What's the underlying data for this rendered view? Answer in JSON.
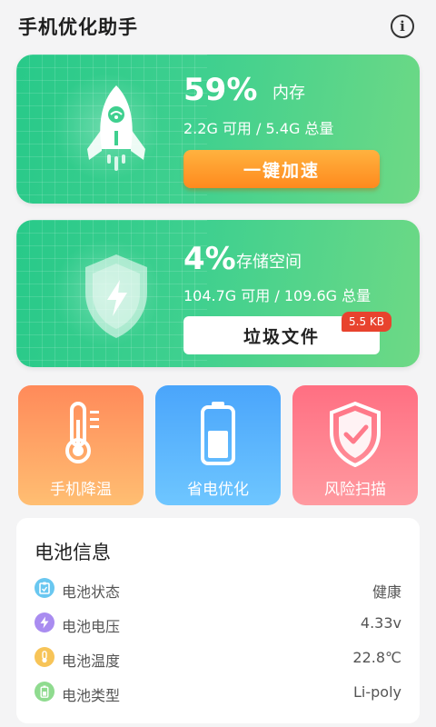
{
  "header": {
    "title": "手机优化助手",
    "info_icon": "info-icon"
  },
  "memory": {
    "percent": "59%",
    "label": "内存",
    "usage": "2.2G 可用 / 5.4G 总量",
    "button": "一键加速",
    "icon": "rocket-icon"
  },
  "storage": {
    "percent": "4%",
    "label": "存储空间",
    "usage": "104.7G 可用 / 109.6G 总量",
    "button": "垃圾文件",
    "badge": "5.5 KB",
    "icon": "shield-bolt-icon"
  },
  "features": [
    {
      "label": "手机降温",
      "icon": "thermometer-icon"
    },
    {
      "label": "省电优化",
      "icon": "battery-icon"
    },
    {
      "label": "风险扫描",
      "icon": "shield-check-icon"
    }
  ],
  "battery": {
    "title": "电池信息",
    "rows": [
      {
        "label": "电池状态",
        "value": "健康",
        "icon": "clipboard-icon",
        "color": "#69c7f0"
      },
      {
        "label": "电池电压",
        "value": "4.33v",
        "icon": "bolt-icon",
        "color": "#a98cf0"
      },
      {
        "label": "电池温度",
        "value": "22.8℃",
        "icon": "thermometer-icon",
        "color": "#f7c458"
      },
      {
        "label": "电池类型",
        "value": "Li-poly",
        "icon": "battery-icon",
        "color": "#8fdb8f"
      }
    ]
  },
  "colors": {
    "card_green": "#3fd08f",
    "accel_orange": "#ff8a1e",
    "badge_red": "#e8432e"
  }
}
